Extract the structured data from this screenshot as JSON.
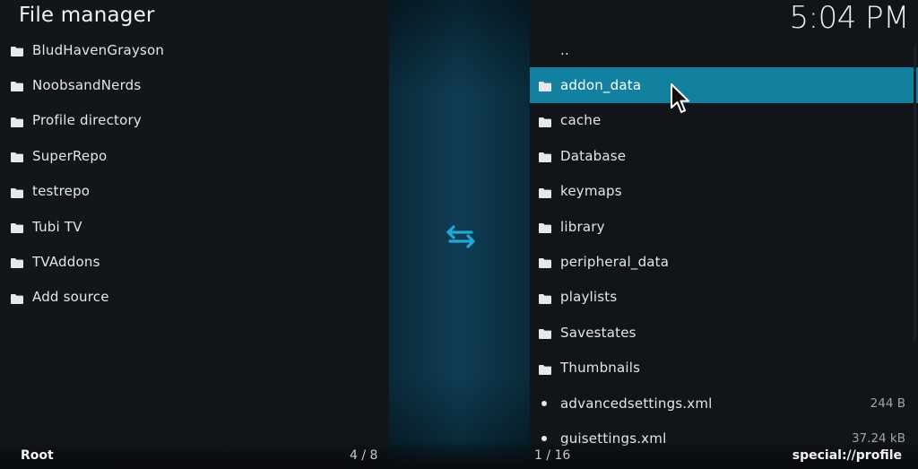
{
  "header": {
    "title": "File manager",
    "clock": "5:04 PM"
  },
  "left_pane": {
    "items": [
      {
        "label": "BludHavenGrayson",
        "type": "folder"
      },
      {
        "label": "NoobsandNerds",
        "type": "folder"
      },
      {
        "label": "Profile directory",
        "type": "folder"
      },
      {
        "label": "SuperRepo",
        "type": "folder"
      },
      {
        "label": "testrepo",
        "type": "folder"
      },
      {
        "label": "Tubi TV",
        "type": "folder"
      },
      {
        "label": "TVAddons",
        "type": "folder"
      },
      {
        "label": "Add source",
        "type": "folder"
      }
    ],
    "footer_label": "Root",
    "footer_count": "4 / 8"
  },
  "right_pane": {
    "items": [
      {
        "label": "..",
        "type": "parent"
      },
      {
        "label": "addon_data",
        "type": "folder",
        "selected": true
      },
      {
        "label": "cache",
        "type": "folder"
      },
      {
        "label": "Database",
        "type": "folder"
      },
      {
        "label": "keymaps",
        "type": "folder"
      },
      {
        "label": "library",
        "type": "folder"
      },
      {
        "label": "peripheral_data",
        "type": "folder"
      },
      {
        "label": "playlists",
        "type": "folder"
      },
      {
        "label": "Savestates",
        "type": "folder"
      },
      {
        "label": "Thumbnails",
        "type": "folder"
      },
      {
        "label": "advancedsettings.xml",
        "type": "file",
        "size": "244 B"
      },
      {
        "label": "guisettings.xml",
        "type": "file",
        "size": "37.24 kB"
      }
    ],
    "footer_count": "1 / 16",
    "footer_path": "special://profile"
  },
  "icons": {
    "folder": "folder-icon",
    "file": "file-icon",
    "swap": "swap-arrows-icon"
  },
  "colors": {
    "accent": "#12809f",
    "swap_icon": "#22a8d4"
  }
}
